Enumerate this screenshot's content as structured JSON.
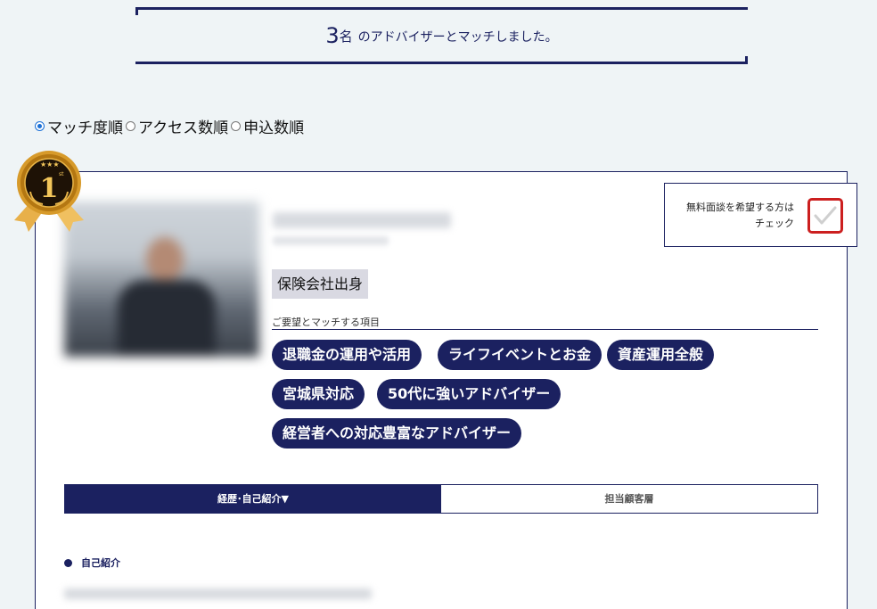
{
  "match_banner": {
    "count": "3",
    "unit": "名",
    "message": "のアドバイザーとマッチしました。"
  },
  "sort_options": [
    {
      "label": "マッチ度順",
      "checked": true
    },
    {
      "label": "アクセス数順",
      "checked": false
    },
    {
      "label": "申込数順",
      "checked": false
    }
  ],
  "advisor_card": {
    "rank_badge": {
      "number": "1",
      "suffix": "st"
    },
    "origin_tag": "保険会社出身",
    "match_items_label": "ご要望とマッチする項目",
    "match_items": [
      "退職金の運用や活用",
      "ライフイベントとお金",
      "資産運用全般",
      "宮城県対応",
      "50代に強いアドバイザー",
      "経営者への対応豊富なアドバイザー"
    ],
    "tabs": [
      {
        "label": "経歴･自己紹介▼",
        "active": true
      },
      {
        "label": "担当顧客層",
        "active": false
      }
    ],
    "intro_heading": "自己紹介"
  },
  "consult_checkbox": {
    "label_line1": "無料面談を希望する方は",
    "label_line2": "チェック",
    "checked": true
  },
  "colors": {
    "navy": "#1b2160",
    "background": "#eff4f6",
    "check_border": "#cc1f1f",
    "radio_accent": "#1a6fd6"
  }
}
